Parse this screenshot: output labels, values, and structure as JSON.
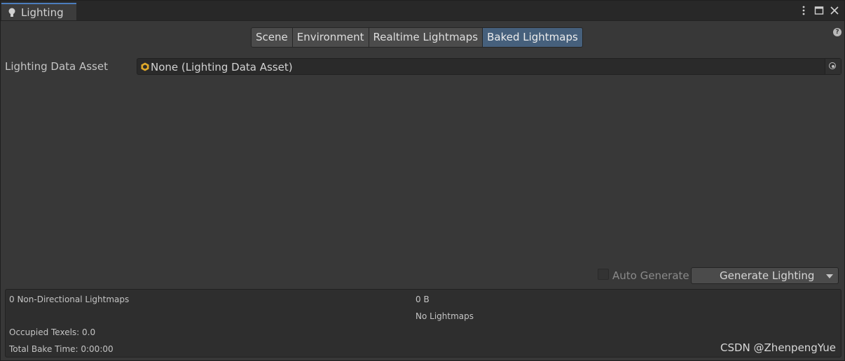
{
  "window": {
    "title": "Lighting",
    "controls": [
      "kebab-menu-icon",
      "maximize-icon",
      "close-icon"
    ]
  },
  "toolbar": {
    "tabs": [
      {
        "label": "Scene",
        "active": false
      },
      {
        "label": "Environment",
        "active": false
      },
      {
        "label": "Realtime Lightmaps",
        "active": false
      },
      {
        "label": "Baked Lightmaps",
        "active": true
      }
    ]
  },
  "help_icon": "?",
  "lighting_data_asset": {
    "label": "Lighting Data Asset",
    "value": "None (Lighting Data Asset)"
  },
  "auto_generate": {
    "label": "Auto Generate",
    "checked": false
  },
  "generate_button": {
    "label": "Generate Lighting"
  },
  "stats": {
    "lightmaps": "0 Non-Directional Lightmaps",
    "size": "0 B",
    "no_lightmaps": "No Lightmaps",
    "occupied_texels": "Occupied Texels: 0.0",
    "total_bake_time": "Total Bake Time: 0:00:00"
  },
  "watermark": "CSDN @ZhenpengYue",
  "colors": {
    "active_tab": "#46607c",
    "tab_accent": "#4c7dbd",
    "asset_icon": "#e0a92a"
  }
}
